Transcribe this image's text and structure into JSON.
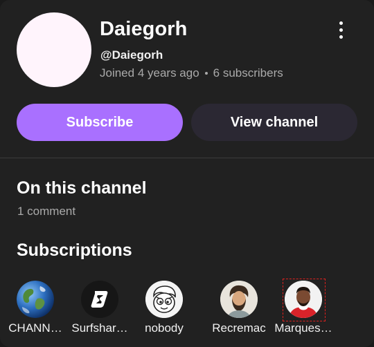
{
  "channel": {
    "name": "Daiegorh",
    "handle": "@Daiegorh",
    "joined": "Joined 4 years ago",
    "subscribers": "6 subscribers"
  },
  "actions": {
    "subscribe_label": "Subscribe",
    "view_channel_label": "View channel",
    "more_icon": "more-vert-icon"
  },
  "on_this_channel": {
    "heading": "On this channel",
    "comment_count": "1 comment"
  },
  "subscriptions": {
    "heading": "Subscriptions",
    "items": [
      {
        "label": "CHANN…",
        "avatar": "earth"
      },
      {
        "label": "Surfshar…",
        "avatar": "surfshark-logo"
      },
      {
        "label": "nobody",
        "avatar": "cartoon-face"
      },
      {
        "label": "Recremac",
        "avatar": "illustrated-man"
      },
      {
        "label": "Marques…",
        "avatar": "person-red-shirt"
      }
    ]
  },
  "colors": {
    "accent": "#a970ff",
    "card": "#212121",
    "secondary_button": "#2b2833",
    "muted_text": "#aaaaaa",
    "avatar_placeholder": "#fff4fc"
  }
}
